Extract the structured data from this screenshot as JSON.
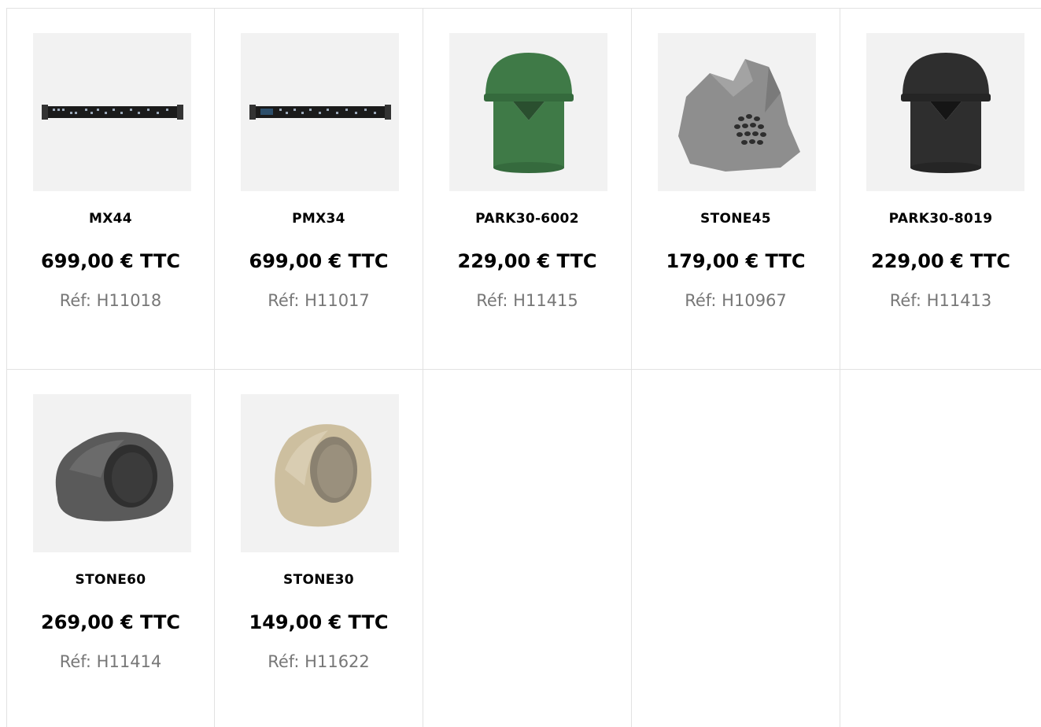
{
  "products": [
    {
      "name": "MX44",
      "price": "699,00 € TTC",
      "ref": "Réf: H11018",
      "image": "rack-mixer-icon"
    },
    {
      "name": "PMX34",
      "price": "699,00 € TTC",
      "ref": "Réf: H11017",
      "image": "rack-mixer-icon"
    },
    {
      "name": "PARK30-6002",
      "price": "229,00 € TTC",
      "ref": "Réf: H11415",
      "image": "garden-speaker-green"
    },
    {
      "name": "STONE45",
      "price": "179,00 € TTC",
      "ref": "Réf: H10967",
      "image": "stone-speaker-grey"
    },
    {
      "name": "PARK30-8019",
      "price": "229,00 € TTC",
      "ref": "Réf: H11413",
      "image": "garden-speaker-black"
    },
    {
      "name": "STONE60",
      "price": "269,00 € TTC",
      "ref": "Réf: H11414",
      "image": "rock-speaker-dark"
    },
    {
      "name": "STONE30",
      "price": "149,00 € TTC",
      "ref": "Réf: H11622",
      "image": "rock-speaker-sand"
    }
  ],
  "colors": {
    "border": "#e2e2e2",
    "thumb_bg": "#f2f2f2",
    "ref_text": "#777777",
    "park_green": "#3f7a47",
    "park_black": "#2e2e2e",
    "stone_grey": "#8e8e8e",
    "rock_dark": "#5a5a5a",
    "rock_sand": "#cdbf9f"
  }
}
